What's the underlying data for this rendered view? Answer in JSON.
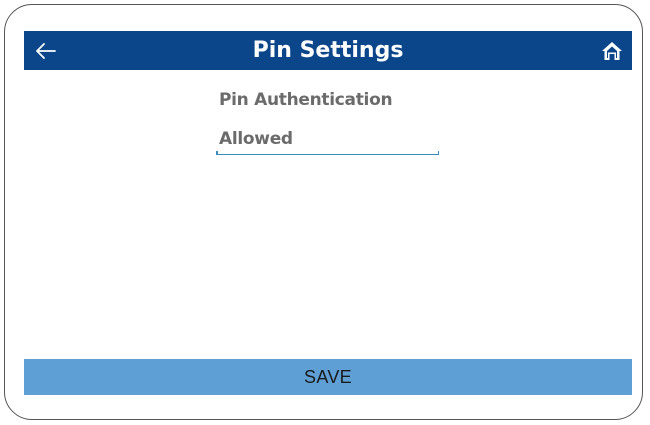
{
  "header": {
    "title": "Pin Settings",
    "back_icon": "arrow-left-icon",
    "home_icon": "home-icon",
    "background_color": "#0b458a"
  },
  "form": {
    "pin_authentication": {
      "label": "Pin Authentication",
      "value": "Allowed",
      "underline_color": "#3a8bc0"
    }
  },
  "footer": {
    "save_label": "SAVE",
    "save_background_color": "#5e9fd6"
  }
}
